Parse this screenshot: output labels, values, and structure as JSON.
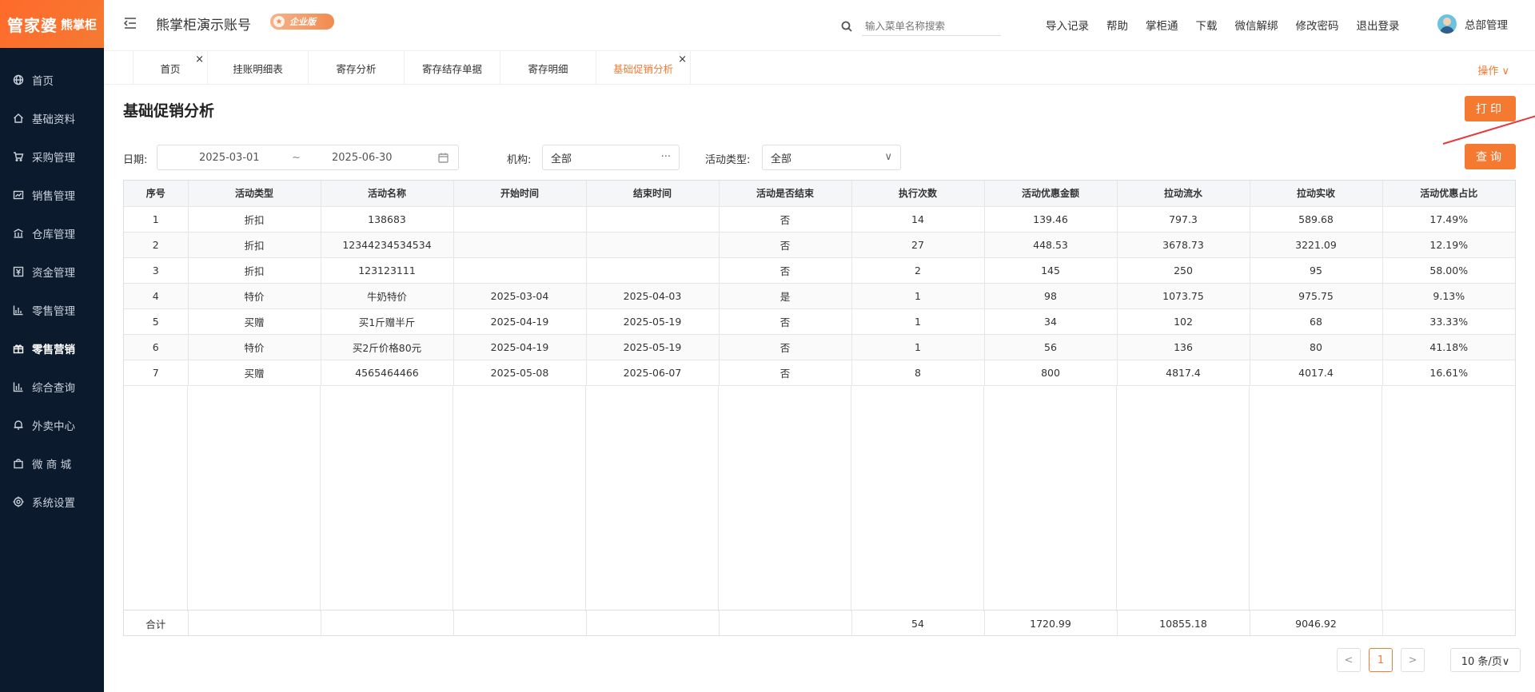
{
  "logo": {
    "text_a": "管家婆",
    "text_b": "熊掌柜"
  },
  "sidebar": {
    "items": [
      {
        "label": "首页",
        "icon": "globe-icon"
      },
      {
        "label": "基础资料",
        "icon": "home-icon"
      },
      {
        "label": "采购管理",
        "icon": "cart-icon"
      },
      {
        "label": "销售管理",
        "icon": "sales-icon"
      },
      {
        "label": "仓库管理",
        "icon": "warehouse-icon"
      },
      {
        "label": "资金管理",
        "icon": "money-icon"
      },
      {
        "label": "零售管理",
        "icon": "chart-icon"
      },
      {
        "label": "零售营销",
        "icon": "gift-icon"
      },
      {
        "label": "综合查询",
        "icon": "bar-chart-icon"
      },
      {
        "label": "外卖中心",
        "icon": "bell-icon"
      },
      {
        "label": "微 商 城",
        "icon": "bag-icon"
      },
      {
        "label": "系统设置",
        "icon": "gear-icon"
      }
    ],
    "active_index": 7
  },
  "header": {
    "account_name": "熊掌柜演示账号",
    "badge": "企业版",
    "search_placeholder": "输入菜单名称搜索",
    "links": [
      "导入记录",
      "帮助",
      "掌柜通",
      "下载",
      "微信解绑",
      "修改密码",
      "退出登录"
    ],
    "user_name": "总部管理"
  },
  "tabs": {
    "items": [
      {
        "label": "首页",
        "closable": true,
        "active": false
      },
      {
        "label": "挂账明细表",
        "closable": false,
        "active": false
      },
      {
        "label": "寄存分析",
        "closable": false,
        "active": false
      },
      {
        "label": "寄存结存单据",
        "closable": false,
        "active": false
      },
      {
        "label": "寄存明细",
        "closable": false,
        "active": false
      },
      {
        "label": "基础促销分析",
        "closable": true,
        "active": true
      }
    ],
    "ops_label": "操作 ∨"
  },
  "page": {
    "title": "基础促销分析",
    "print_label": "打印",
    "query_label": "查询"
  },
  "filters": {
    "date_label": "日期:",
    "date_start": "2025-03-01",
    "date_sep": "~",
    "date_end": "2025-06-30",
    "org_label": "机构:",
    "org_value": "全部",
    "type_label": "活动类型:",
    "type_value": "全部"
  },
  "table": {
    "columns": [
      "序号",
      "活动类型",
      "活动名称",
      "开始时间",
      "结束时间",
      "活动是否结束",
      "执行次数",
      "活动优惠金额",
      "拉动流水",
      "拉动实收",
      "活动优惠占比"
    ],
    "rows": [
      [
        "1",
        "折扣",
        "138683",
        "",
        "",
        "否",
        "14",
        "139.46",
        "797.3",
        "589.68",
        "17.49%"
      ],
      [
        "2",
        "折扣",
        "12344234534534",
        "",
        "",
        "否",
        "27",
        "448.53",
        "3678.73",
        "3221.09",
        "12.19%"
      ],
      [
        "3",
        "折扣",
        "123123111",
        "",
        "",
        "否",
        "2",
        "145",
        "250",
        "95",
        "58.00%"
      ],
      [
        "4",
        "特价",
        "牛奶特价",
        "2025-03-04",
        "2025-04-03",
        "是",
        "1",
        "98",
        "1073.75",
        "975.75",
        "9.13%"
      ],
      [
        "5",
        "买赠",
        "买1斤赠半斤",
        "2025-04-19",
        "2025-05-19",
        "否",
        "1",
        "34",
        "102",
        "68",
        "33.33%"
      ],
      [
        "6",
        "特价",
        "买2斤价格80元",
        "2025-04-19",
        "2025-05-19",
        "否",
        "1",
        "56",
        "136",
        "80",
        "41.18%"
      ],
      [
        "7",
        "买赠",
        "4565464466",
        "2025-05-08",
        "2025-06-07",
        "否",
        "8",
        "800",
        "4817.4",
        "4017.4",
        "16.61%"
      ]
    ],
    "total": [
      "合计",
      "",
      "",
      "",
      "",
      "",
      "54",
      "1720.99",
      "10855.18",
      "9046.92",
      ""
    ]
  },
  "pagination": {
    "prev": "<",
    "current": "1",
    "next": ">",
    "page_size": "10 条/页∨"
  },
  "colors": {
    "accent": "#f47a32",
    "sidebar_bg": "#0b1a2c"
  }
}
